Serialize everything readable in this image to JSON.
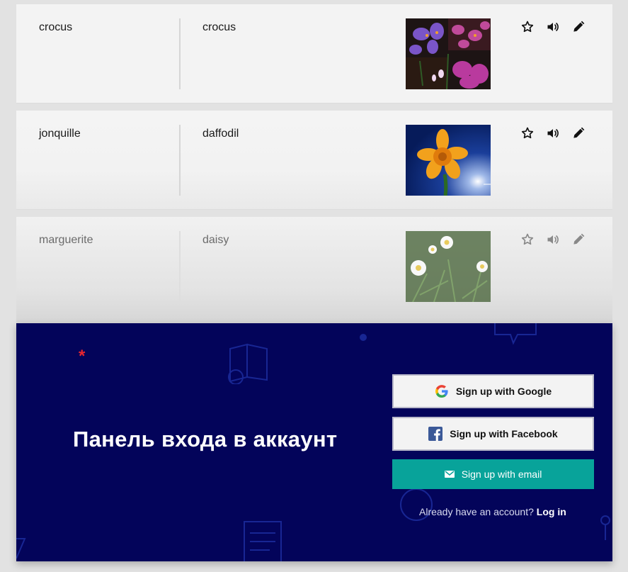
{
  "rows": [
    {
      "term": "crocus",
      "definition": "crocus",
      "image": "crocus-photo"
    },
    {
      "term": "jonquille",
      "definition": "daffodil",
      "image": "daffodil-photo"
    },
    {
      "term": "marguerite",
      "definition": "daisy",
      "image": "daisy-photo"
    }
  ],
  "row_actions": [
    "star-icon",
    "speaker-icon",
    "pencil-icon"
  ],
  "signup": {
    "asterisk": "*",
    "title": "Панель входа в аккаунт",
    "google_label": "Sign up with Google",
    "facebook_label": "Sign up with Facebook",
    "email_label": "Sign up with email",
    "login_prompt": "Already have an account?",
    "login_link": "Log in",
    "colors": {
      "panel_bg": "#03045a",
      "email_button": "#08a39a",
      "asterisk": "#e8262f"
    }
  }
}
